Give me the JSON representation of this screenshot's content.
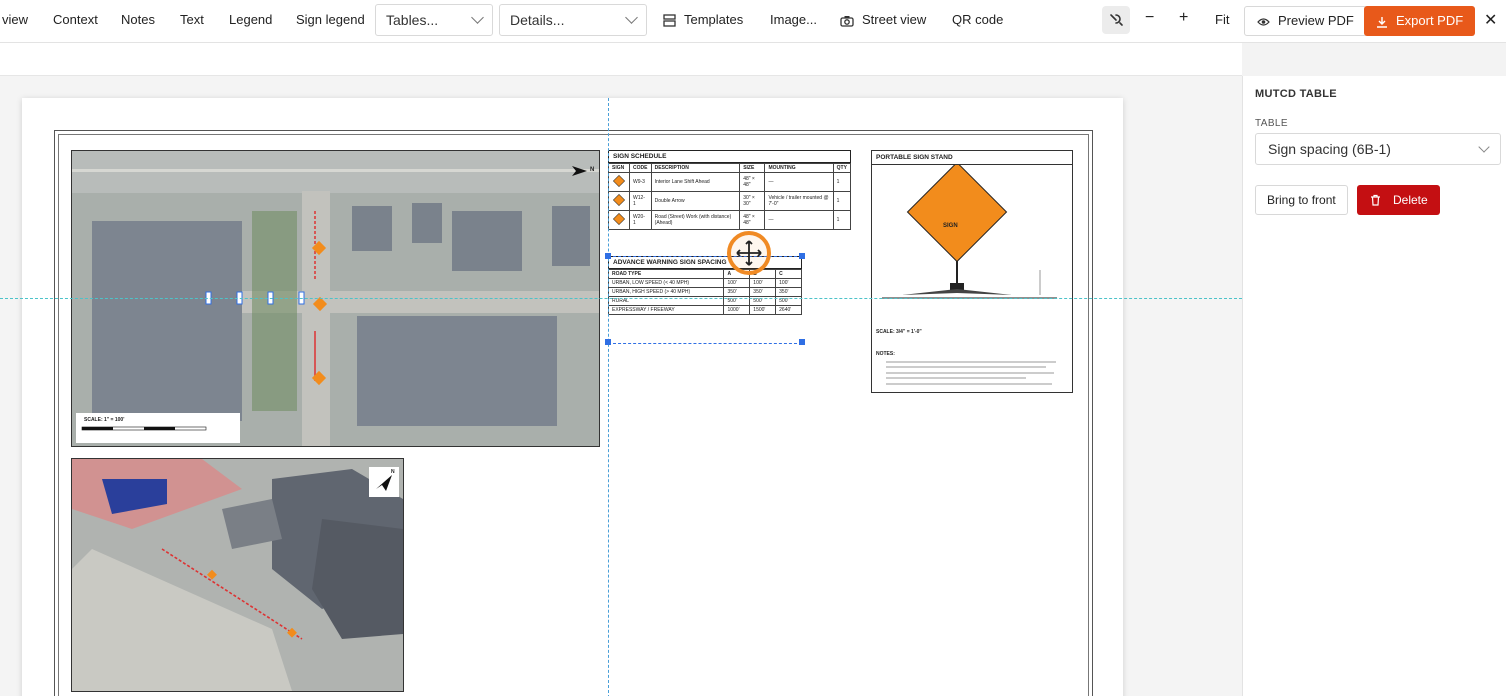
{
  "toolbar": {
    "items": [
      "view",
      "Context",
      "Notes",
      "Text",
      "Legend",
      "Sign legend"
    ],
    "tables_select": "Tables...",
    "details_select": "Details...",
    "templates": "Templates",
    "image": "Image...",
    "street_view": "Street view",
    "qr_code": "QR code",
    "zoom_fit": "Fit",
    "preview_pdf": "Preview PDF",
    "export_pdf": "Export PDF"
  },
  "panel": {
    "title": "MUTCD TABLE",
    "table_label": "TABLE",
    "table_value": "Sign spacing (6B-1)",
    "bring_to_front": "Bring to front",
    "delete": "Delete"
  },
  "sheet": {
    "sign_schedule": {
      "title": "SIGN SCHEDULE",
      "headers": [
        "SIGN",
        "CODE",
        "DESCRIPTION",
        "SIZE",
        "MOUNTING",
        "QTY"
      ],
      "rows": [
        [
          "",
          "W9-3",
          "Interior Lane Shift Ahead",
          "48\" × 48\"",
          "—",
          "1"
        ],
        [
          "",
          "W12-1",
          "Double Arrow",
          "30\" × 30\"",
          "Vehicle / trailer mounted @ 7'-0\"",
          "1"
        ],
        [
          "",
          "W20-1",
          "Road (Street) Work (with distance) (Ahead)",
          "48\" × 48\"",
          "—",
          "1"
        ]
      ]
    },
    "advance_warning": {
      "title": "ADVANCE WARNING SIGN SPACING",
      "headers": [
        "ROAD TYPE",
        "A",
        "B",
        "C"
      ],
      "rows": [
        [
          "URBAN, LOW SPEED (< 40 MPH)",
          "100'",
          "100'",
          "100'"
        ],
        [
          "URBAN, HIGH SPEED (> 40 MPH)",
          "350'",
          "350'",
          "350'"
        ],
        [
          "RURAL",
          "500'",
          "500'",
          "500'"
        ],
        [
          "EXPRESSWAY / FREEWAY",
          "1000'",
          "1500'",
          "2640'"
        ]
      ]
    },
    "portable_stand": {
      "title": "PORTABLE SIGN STAND",
      "sign_text": "SIGN",
      "scale": "SCALE: 3/4\" = 1'-0\"",
      "notes_title": "NOTES:"
    },
    "aerial": {
      "scale": "SCALE: 1\" = 100'",
      "north": "N"
    },
    "view3d": {
      "north": "N"
    }
  },
  "colors": {
    "accent_orange": "#e8591a",
    "delete_red": "#c40f12",
    "selection_blue": "#2f6fe4",
    "guide_cyan": "#4cc3c9",
    "sign_orange": "#f28c1c"
  }
}
